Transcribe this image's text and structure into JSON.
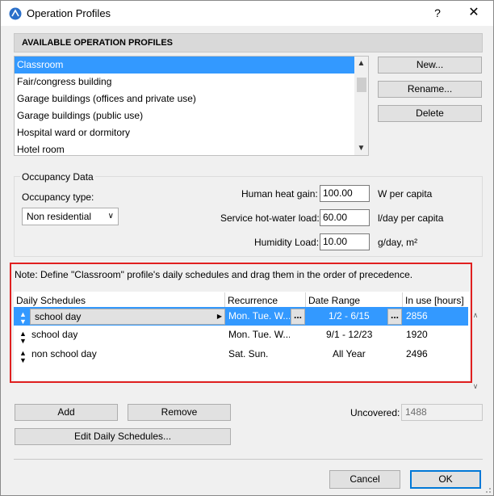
{
  "window": {
    "title": "Operation Profiles",
    "help": "?",
    "close": "✕"
  },
  "profiles": {
    "header": "AVAILABLE OPERATION PROFILES",
    "items": [
      "Classroom",
      "Fair/congress building",
      "Garage buildings (offices and private use)",
      "Garage buildings (public use)",
      "Hospital ward or dormitory",
      "Hotel room"
    ],
    "selected_index": 0,
    "buttons": {
      "new": "New...",
      "rename": "Rename...",
      "delete": "Delete"
    }
  },
  "occupancy": {
    "legend": "Occupancy Data",
    "type_label": "Occupancy type:",
    "type_value": "Non residential",
    "heat_label": "Human heat gain:",
    "heat_value": "100.00",
    "heat_unit": "W per capita",
    "water_label": "Service hot-water load:",
    "water_value": "60.00",
    "water_unit": "l/day per capita",
    "humidity_label": "Humidity Load:",
    "humidity_value": "10.00",
    "humidity_unit": "g/day, m²"
  },
  "schedules": {
    "note": "Note: Define \"Classroom\" profile's daily schedules and drag them in the order of precedence.",
    "columns": {
      "name": "Daily Schedules",
      "recurrence": "Recurrence",
      "range": "Date Range",
      "inuse": "In use [hours]"
    },
    "rows": [
      {
        "name": "school day",
        "recurrence": "Mon. Tue. W...",
        "range": "1/2 - 6/15",
        "inuse": "2856"
      },
      {
        "name": "school day",
        "recurrence": "Mon. Tue. W...",
        "range": "9/1 - 12/23",
        "inuse": "1920"
      },
      {
        "name": "non school day",
        "recurrence": "Sat. Sun.",
        "range": "All Year",
        "inuse": "2496"
      }
    ],
    "dots": "...",
    "buttons": {
      "add": "Add",
      "remove": "Remove",
      "edit": "Edit Daily Schedules..."
    },
    "uncovered_label": "Uncovered:",
    "uncovered_value": "1488"
  },
  "footer": {
    "cancel": "Cancel",
    "ok": "OK"
  }
}
